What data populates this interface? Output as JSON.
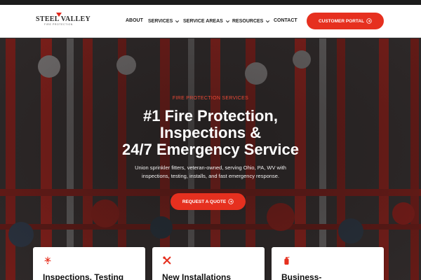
{
  "header": {
    "logo": {
      "main": "STEEL VALLEY",
      "sub": "FIRE PROTECTION"
    },
    "nav": [
      {
        "label": "ABOUT",
        "has_dropdown": false
      },
      {
        "label": "SERVICES",
        "has_dropdown": true
      },
      {
        "label": "SERVICE AREAS",
        "has_dropdown": true
      },
      {
        "label": "RESOURCES",
        "has_dropdown": true
      },
      {
        "label": "CONTACT",
        "has_dropdown": false
      }
    ],
    "portal_button": "CUSTOMER PORTAL"
  },
  "hero": {
    "eyebrow": "FIRE PROTECTION SERVICES",
    "headline_lines": [
      "#1 Fire Protection,",
      "Inspections &",
      "24/7 Emergency Service"
    ],
    "subtext_lines": [
      "Union sprinkler fitters, veteran-owned, serving Ohio, PA, WV with",
      "inspections, testing, installs, and fast emergency response."
    ],
    "cta": "REQUEST A QUOTE"
  },
  "cards": [
    {
      "title": "Inspections, Testing",
      "icon": "sprinkler-icon"
    },
    {
      "title": "New Installations",
      "icon": "tools-icon"
    },
    {
      "title": "Business-",
      "icon": "fire-extinguisher-icon"
    }
  ],
  "colors": {
    "accent": "#e6301f",
    "eyebrow": "#ee4a36",
    "nav_text": "#1e1e1e",
    "hero_text": "#ffffff"
  }
}
